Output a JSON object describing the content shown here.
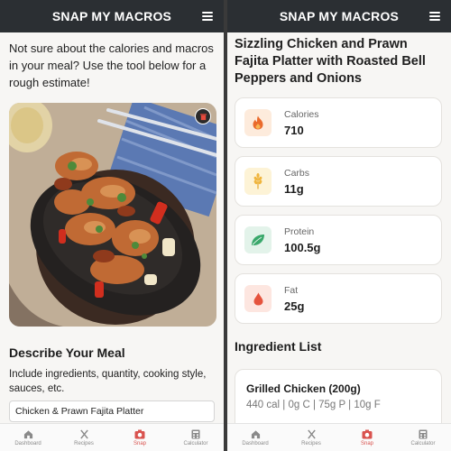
{
  "app": {
    "title": "SNAP MY MACROS"
  },
  "colors": {
    "appbar": "#2b2f33",
    "accent": "#d9534f",
    "calories_bg": "#fdebdc",
    "carbs_bg": "#fdf3d6",
    "protein_bg": "#e3f3ea",
    "fat_bg": "#fde6e0"
  },
  "left": {
    "intro": "Not sure about the calories and macros in your meal? Use the tool below for a rough estimate!",
    "describe_title": "Describe Your Meal",
    "describe_help": "Include ingredients, quantity, cooking style, sauces, etc.",
    "meal_input_value": "Chicken & Prawn Fajita Platter"
  },
  "right": {
    "dish_title": "Sizzling Chicken and Prawn Fajita Platter with Roasted Bell Peppers and Onions",
    "macros": [
      {
        "label": "Calories",
        "value": "710",
        "icon": "flame-icon"
      },
      {
        "label": "Carbs",
        "value": "11g",
        "icon": "wheat-icon"
      },
      {
        "label": "Protein",
        "value": "100.5g",
        "icon": "leaf-icon"
      },
      {
        "label": "Fat",
        "value": "25g",
        "icon": "drop-icon"
      }
    ],
    "ingredient_heading": "Ingredient List",
    "ingredients": [
      {
        "name": "Grilled Chicken (200g)",
        "stats": "440 cal | 0g C | 75g P | 10g F"
      }
    ]
  },
  "nav": [
    {
      "label": "Dashboard",
      "icon": "home-icon"
    },
    {
      "label": "Recipes",
      "icon": "utensils-icon"
    },
    {
      "label": "Snap",
      "icon": "camera-icon",
      "active": true
    },
    {
      "label": "Calculator",
      "icon": "calculator-icon"
    }
  ]
}
